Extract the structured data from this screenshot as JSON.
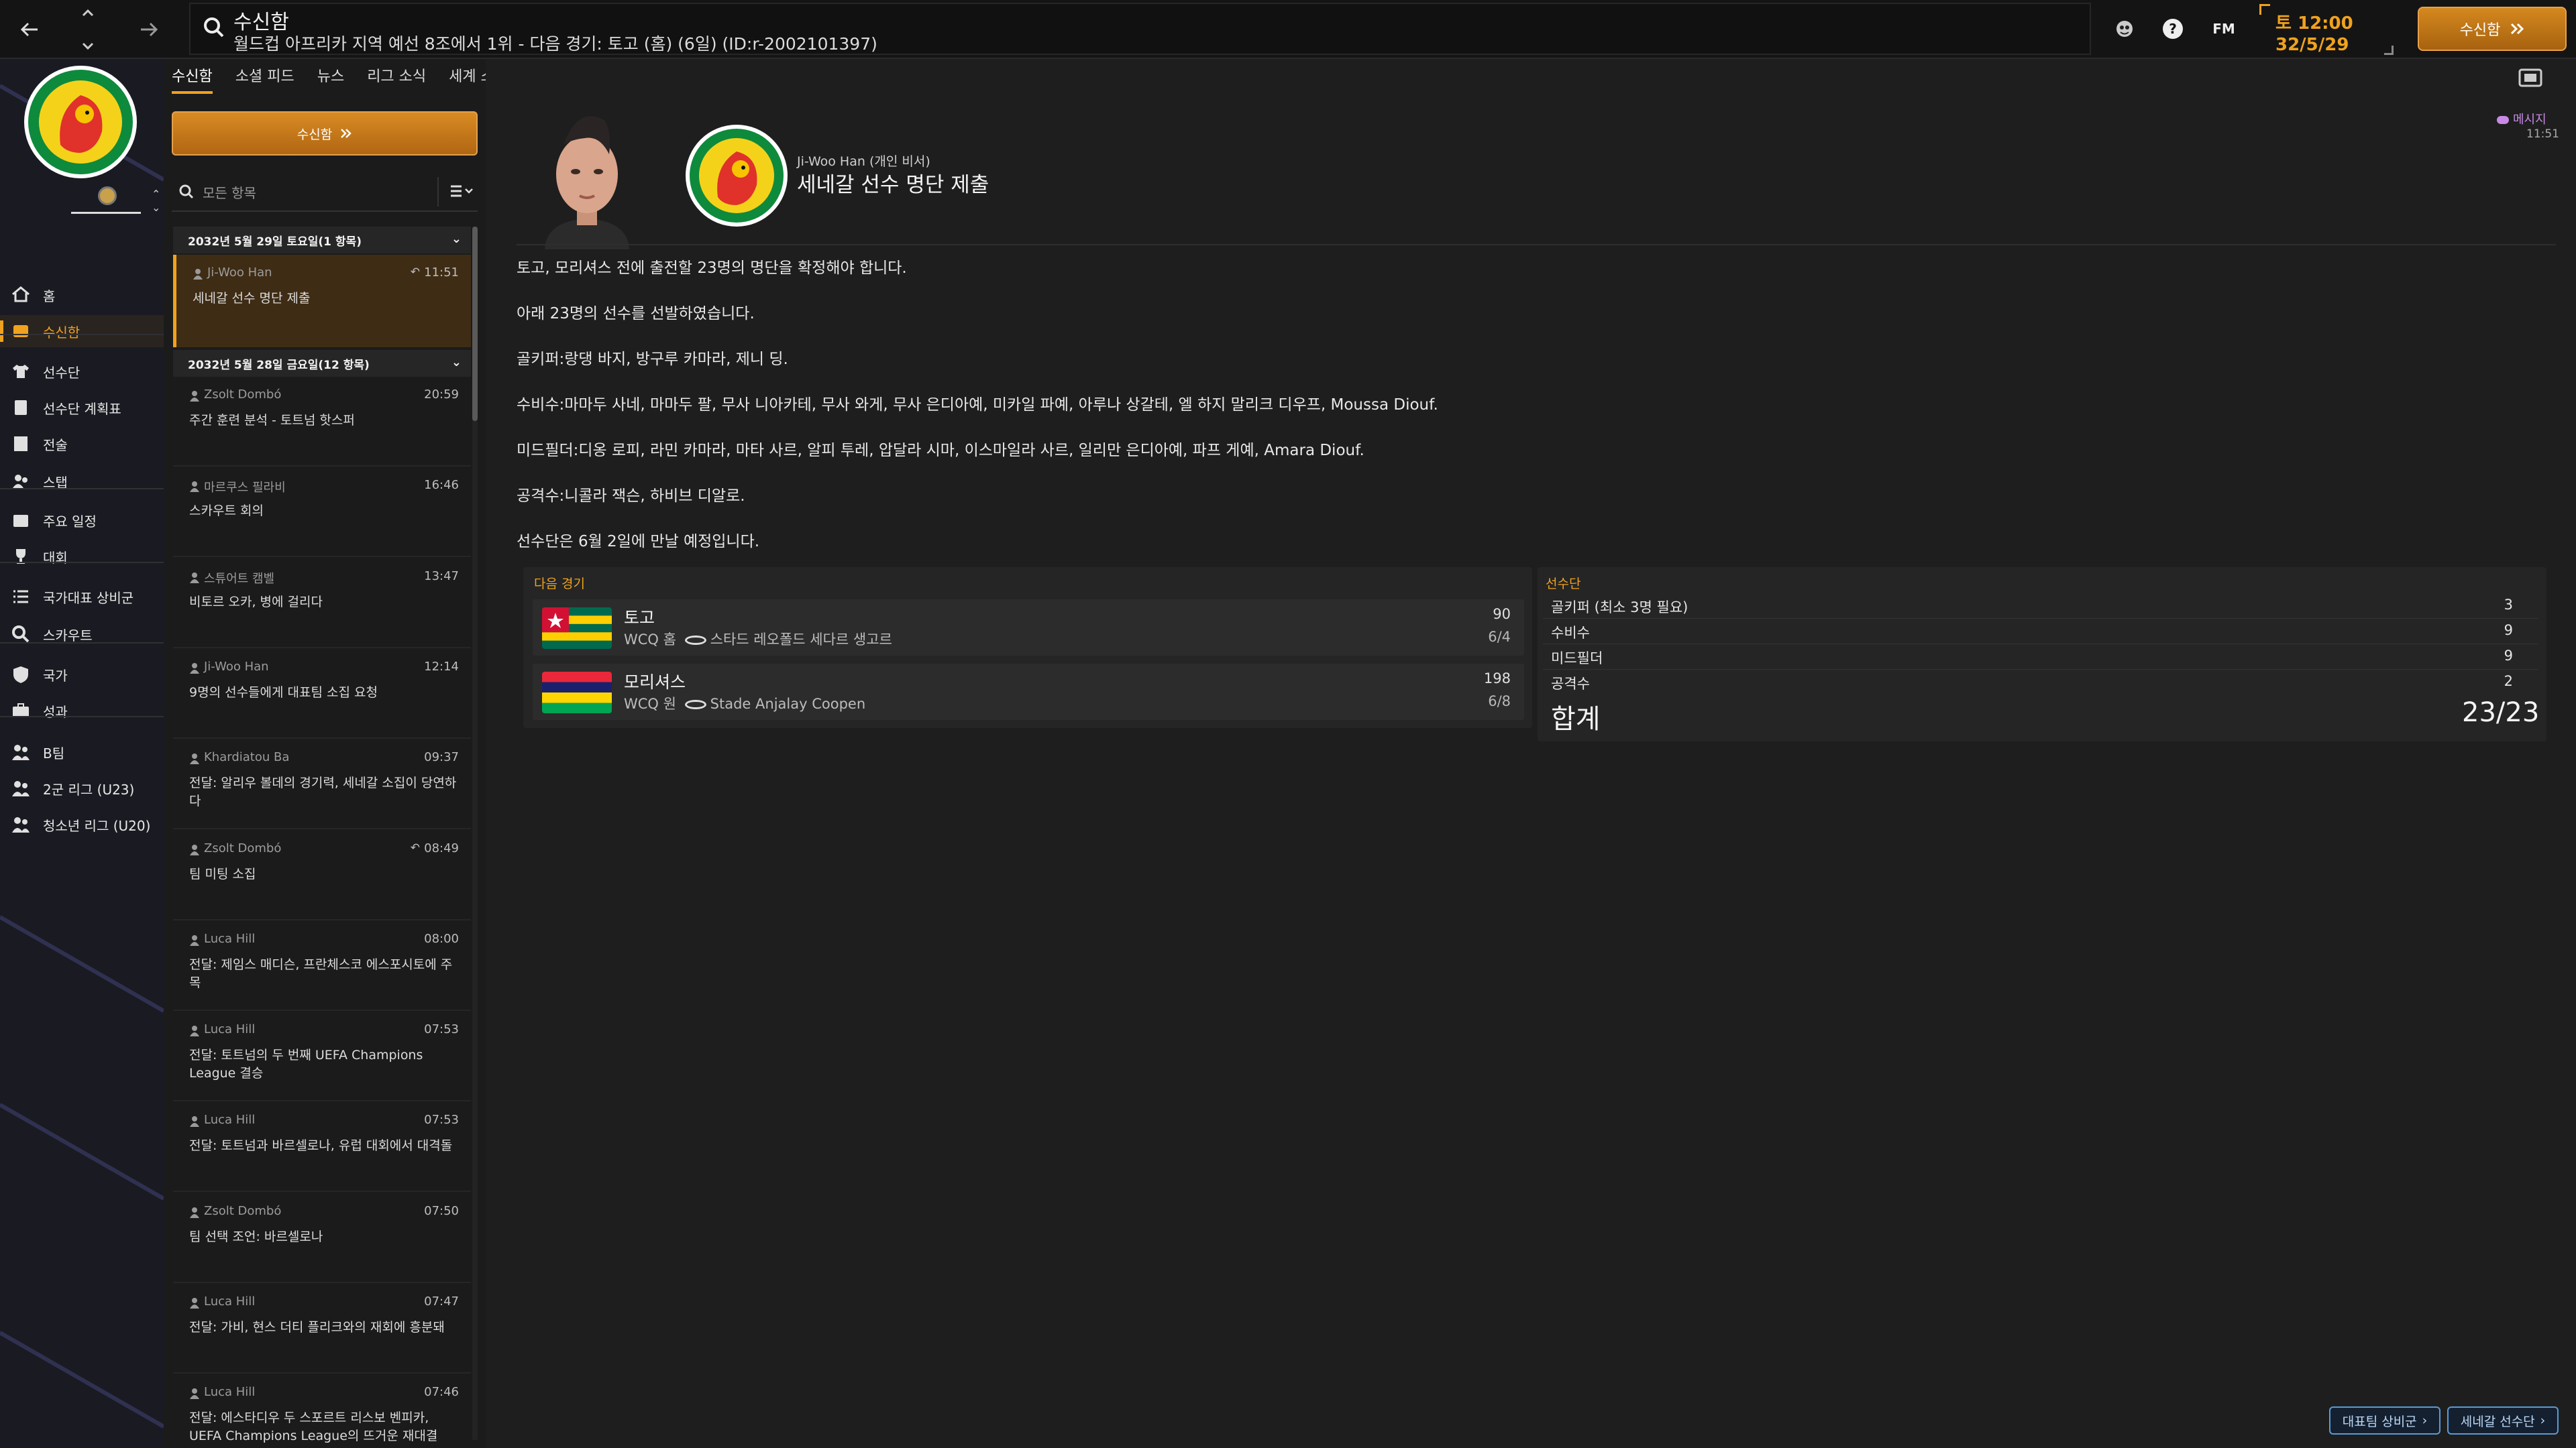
{
  "topbar": {
    "title": "수신함",
    "subtitle": "월드컵 아프리카 지역 예선 8조에서 1위 - 다음 경기: 토고 (홈) (6일) (ID:r-2002101397)",
    "fm_label": "FM",
    "day_time": "토 12:00",
    "date": "32/5/29",
    "continue_label": "수신함"
  },
  "sidebar": {
    "items": [
      {
        "label": "홈",
        "icon": "home-icon"
      },
      {
        "label": "수신함",
        "icon": "inbox-icon"
      },
      {
        "label": "선수단",
        "icon": "shirt-icon"
      },
      {
        "label": "선수단 계획표",
        "icon": "clipboard-icon"
      },
      {
        "label": "전술",
        "icon": "tactics-icon"
      },
      {
        "label": "스탭",
        "icon": "staff-icon"
      },
      {
        "label": "주요 일정",
        "icon": "calendar-icon"
      },
      {
        "label": "대회",
        "icon": "trophy-icon"
      },
      {
        "label": "국가대표 상비군",
        "icon": "list-icon"
      },
      {
        "label": "스카우트",
        "icon": "magnifier-icon"
      },
      {
        "label": "국가",
        "icon": "shield-icon"
      },
      {
        "label": "성과",
        "icon": "briefcase-icon"
      },
      {
        "label": "B팀",
        "icon": "team-icon"
      },
      {
        "label": "2군 리그 (U23)",
        "icon": "team-icon"
      },
      {
        "label": "청소년 리그 (U20)",
        "icon": "team-icon"
      }
    ]
  },
  "subtabs": [
    "수신함",
    "소셜 피드",
    "뉴스",
    "리그 소식",
    "세계 소식"
  ],
  "inbox_button": "수신함",
  "search": {
    "placeholder": "모든 항목"
  },
  "groups": [
    {
      "label": "2032년 5월 29일 토요일(1 항목)"
    },
    {
      "label": "2032년 5월 28일 금요일(12 항목)"
    }
  ],
  "messages": [
    {
      "sender": "Ji-Woo Han",
      "time": "11:51",
      "subject": "세네갈 선수 명단 제출",
      "reply": true
    },
    {
      "sender": "Zsolt Dombó",
      "time": "20:59",
      "subject": "주간 훈련 분석 - 토트넘 핫스퍼"
    },
    {
      "sender": "마르쿠스 필라비",
      "time": "16:46",
      "subject": "스카우트 회의"
    },
    {
      "sender": "스튜어트 캠벨",
      "time": "13:47",
      "subject": "비토르 오카, 병에 걸리다"
    },
    {
      "sender": "Ji-Woo Han",
      "time": "12:14",
      "subject": "9명의 선수들에게 대표팀 소집 요청"
    },
    {
      "sender": "Khardiatou Ba",
      "time": "09:37",
      "subject": "전달: 알리우 볼데의 경기력, 세네갈 소집이 당연하다"
    },
    {
      "sender": "Zsolt Dombó",
      "time": "08:49",
      "subject": "팀 미팅 소집",
      "reply": true
    },
    {
      "sender": "Luca Hill",
      "time": "08:00",
      "subject": "전달: 제임스 매디슨, 프란체스코 에스포시토에 주목"
    },
    {
      "sender": "Luca Hill",
      "time": "07:53",
      "subject": "전달: 토트넘의 두 번째 UEFA Champions League 결승"
    },
    {
      "sender": "Luca Hill",
      "time": "07:53",
      "subject": "전달: 토트넘과 바르셀로나, 유럽 대회에서 대격돌"
    },
    {
      "sender": "Zsolt Dombó",
      "time": "07:50",
      "subject": "팀 선택 조언: 바르셀로나"
    },
    {
      "sender": "Luca Hill",
      "time": "07:47",
      "subject": "전달: 가비, 현스 더티 플리크와의 재회에 흥분돼"
    },
    {
      "sender": "Luca Hill",
      "time": "07:46",
      "subject": "전달: 에스타디우 두 스포르트 리스보 벤피카, UEFA Champions League의 뜨거운 재대결"
    }
  ],
  "message": {
    "sender": "Ji-Woo Han (개인 비서)",
    "subject": "세네갈 선수 명단 제출",
    "tag": "메시지",
    "time": "11:51",
    "paragraphs": [
      "토고, 모리셔스 전에 출전할 23명의 명단을 확정해야 합니다.",
      "아래 23명의 선수를 선발하였습니다.",
      "골키퍼:랑댕 바지, 방구루 카마라, 제니 딩.",
      "수비수:마마두 사네, 마마두 팔, 무사 니아카테, 무사 와게, 무사 은디아예, 미카일 파예, 아루나 상갈테, 엘 하지 말리크 디우프, Moussa Diouf.",
      "미드필더:디옹 로피, 라민 카마라, 마타 사르, 알피 투레, 압달라 시마, 이스마일라 사르, 일리만 은디아예, 파프 게예, Amara Diouf.",
      "공격수:니콜라 잭슨, 하비브 디알로.",
      "선수단은 6월 2일에 만날 예정입니다."
    ]
  },
  "fixtures": {
    "title": "다음 경기",
    "items": [
      {
        "team": "토고",
        "comp": "WCQ",
        "venue_type": "홈",
        "stadium": "스타드 레오폴드 세다르 생고르",
        "rank": "90",
        "record": "6/4"
      },
      {
        "team": "모리셔스",
        "comp": "WCQ",
        "venue_type": "원",
        "stadium": "Stade Anjalay Coopen",
        "rank": "198",
        "record": "6/8"
      }
    ]
  },
  "squad": {
    "title": "선수단",
    "rows": [
      {
        "label": "골키퍼 (최소 3명 필요)",
        "value": "3"
      },
      {
        "label": "수비수",
        "value": "9"
      },
      {
        "label": "미드필더",
        "value": "9"
      },
      {
        "label": "공격수",
        "value": "2"
      }
    ],
    "total_label": "합계",
    "total_value": "23/23"
  },
  "footer": {
    "btn1": "대표팀 상비군",
    "btn2": "세네갈 선수단"
  },
  "colors": {
    "accent": "#f0a21e",
    "selected_bg": "#3f2c15",
    "tag_purple": "#c88ae6"
  }
}
